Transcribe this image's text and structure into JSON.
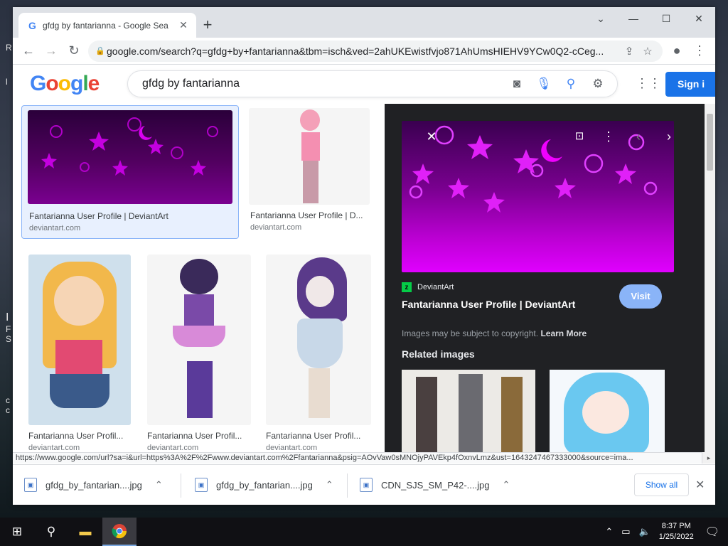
{
  "desktop": {
    "fragments": [
      "R",
      "l",
      "I",
      "F",
      "S",
      "c",
      "c"
    ]
  },
  "browser": {
    "tab_title": "gfdg by fantarianna - Google Sea",
    "tab_favicon": "G",
    "new_tab": "+",
    "address_url": "google.com/search?q=gfdg+by+fantarianna&tbm=isch&ved=2ahUKEwistfvjo871AhUmsHIEHV9YCw0Q2-cCeg...",
    "status_url": "https://www.google.com/url?sa=i&url=https%3A%2F%2Fwww.deviantart.com%2Ffantarianna&psig=AOvVaw0sMNOjyPAVEkp4fOxnvLmz&ust=1643247467333000&source=ima..."
  },
  "google": {
    "logo_letters": [
      "G",
      "o",
      "o",
      "g",
      "l",
      "e"
    ],
    "logo_colors": [
      "#4285f4",
      "#ea4335",
      "#fbbc05",
      "#4285f4",
      "#34a853",
      "#ea4335"
    ],
    "query": "gfdg by fantarianna",
    "signin_label": "Sign i"
  },
  "results": [
    {
      "title": "Fantarianna User Profile | DeviantArt",
      "source": "deviantart.com"
    },
    {
      "title": "Fantarianna User Profile | D...",
      "source": "deviantart.com"
    },
    {
      "title": "Fantarianna User Profil...",
      "source": "deviantart.com"
    },
    {
      "title": "Fantarianna User Profil...",
      "source": "deviantart.com"
    },
    {
      "title": "Fantarianna User Profil...",
      "source": "deviantart.com"
    }
  ],
  "panel": {
    "source_name": "DeviantArt",
    "title": "Fantarianna User Profile | DeviantArt",
    "visit_label": "Visit",
    "copyright_text": "Images may be subject to copyright.",
    "learn_more": "Learn More",
    "related_heading": "Related images"
  },
  "downloads": {
    "items": [
      "gfdg_by_fantarian....jpg",
      "gfdg_by_fantarian....jpg",
      "CDN_SJS_SM_P42-....jpg"
    ],
    "show_all": "Show all"
  },
  "taskbar": {
    "time": "8:37 PM",
    "date": "1/25/2022"
  },
  "colors": {
    "accent": "#1a73e8",
    "panel_bg": "#202124",
    "visit": "#8ab4f8",
    "deviantart": "#05cc47"
  }
}
